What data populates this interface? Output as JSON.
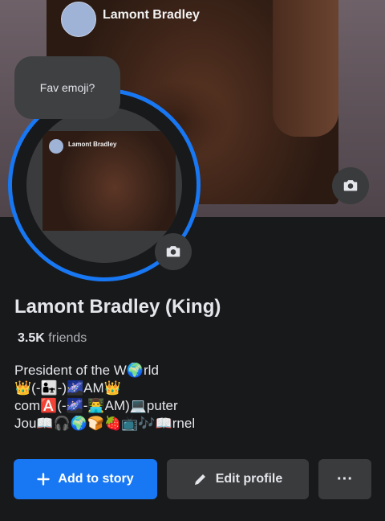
{
  "cover": {
    "overlay_name": "Lamont Bradley"
  },
  "avatar": {
    "overlay_name": "Lamont Bradley"
  },
  "tooltip": {
    "text": "Fav emoji?"
  },
  "profile": {
    "name": "Lamont Bradley (King)",
    "friends_count": "3.5K",
    "friends_label": "friends",
    "bio_lines": [
      "President of the W🌍rld",
      "👑(-👨‍👧-)🌌AM👑",
      "com🅰️(-🌌-👨‍💻AM)💻puter",
      "Jou📖🎧🌍🍞🍓📺🎶📖rnel"
    ]
  },
  "actions": {
    "add_story": "Add to story",
    "edit_profile": "Edit profile",
    "more": "···"
  },
  "icons": {
    "cover_camera": "camera-icon",
    "avatar_camera": "camera-icon",
    "add": "plus-icon",
    "edit": "pencil-icon",
    "more": "more-icon"
  },
  "colors": {
    "accent": "#1877f2",
    "background": "#18191a",
    "button": "#3a3b3c"
  }
}
